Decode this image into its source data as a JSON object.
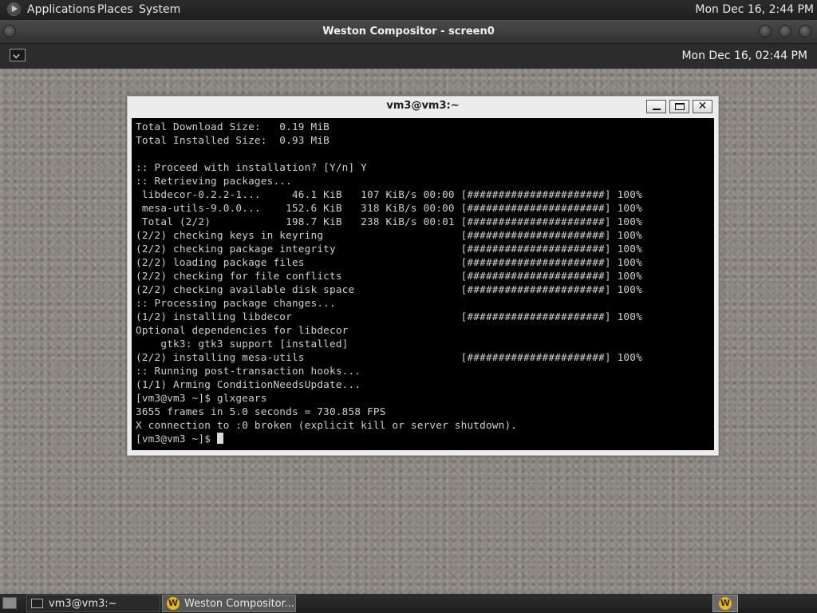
{
  "top_panel": {
    "menus": [
      "Applications",
      "Places",
      "System"
    ],
    "clock": "Mon Dec 16,  2:44 PM"
  },
  "weston_window": {
    "title": "Weston Compositor - screen0"
  },
  "weston_panel": {
    "clock": "Mon Dec 16, 02:44 PM"
  },
  "terminal": {
    "title": "vm3@vm3:~",
    "close_glyph": "✕",
    "lines": [
      "Total Download Size:   0.19 MiB",
      "Total Installed Size:  0.93 MiB",
      "",
      ":: Proceed with installation? [Y/n] Y",
      ":: Retrieving packages...",
      " libdecor-0.2.2-1...     46.1 KiB   107 KiB/s 00:00 [######################] 100%",
      " mesa-utils-9.0.0...    152.6 KiB   318 KiB/s 00:00 [######################] 100%",
      " Total (2/2)            198.7 KiB   238 KiB/s 00:01 [######################] 100%",
      "(2/2) checking keys in keyring                      [######################] 100%",
      "(2/2) checking package integrity                    [######################] 100%",
      "(2/2) loading package files                         [######################] 100%",
      "(2/2) checking for file conflicts                   [######################] 100%",
      "(2/2) checking available disk space                 [######################] 100%",
      ":: Processing package changes...",
      "(1/2) installing libdecor                           [######################] 100%",
      "Optional dependencies for libdecor",
      "    gtk3: gtk3 support [installed]",
      "(2/2) installing mesa-utils                         [######################] 100%",
      ":: Running post-transaction hooks...",
      "(1/1) Arming ConditionNeedsUpdate...",
      "[vm3@vm3 ~]$ glxgears",
      "3655 frames in 5.0 seconds = 730.858 FPS",
      "X connection to :0 broken (explicit kill or server shutdown)."
    ],
    "prompt": "[vm3@vm3 ~]$ "
  },
  "bottom_panel": {
    "tasks": [
      {
        "label": "vm3@vm3:~"
      },
      {
        "label": "Weston Compositor..."
      }
    ],
    "weston_icon_letter": "W"
  }
}
